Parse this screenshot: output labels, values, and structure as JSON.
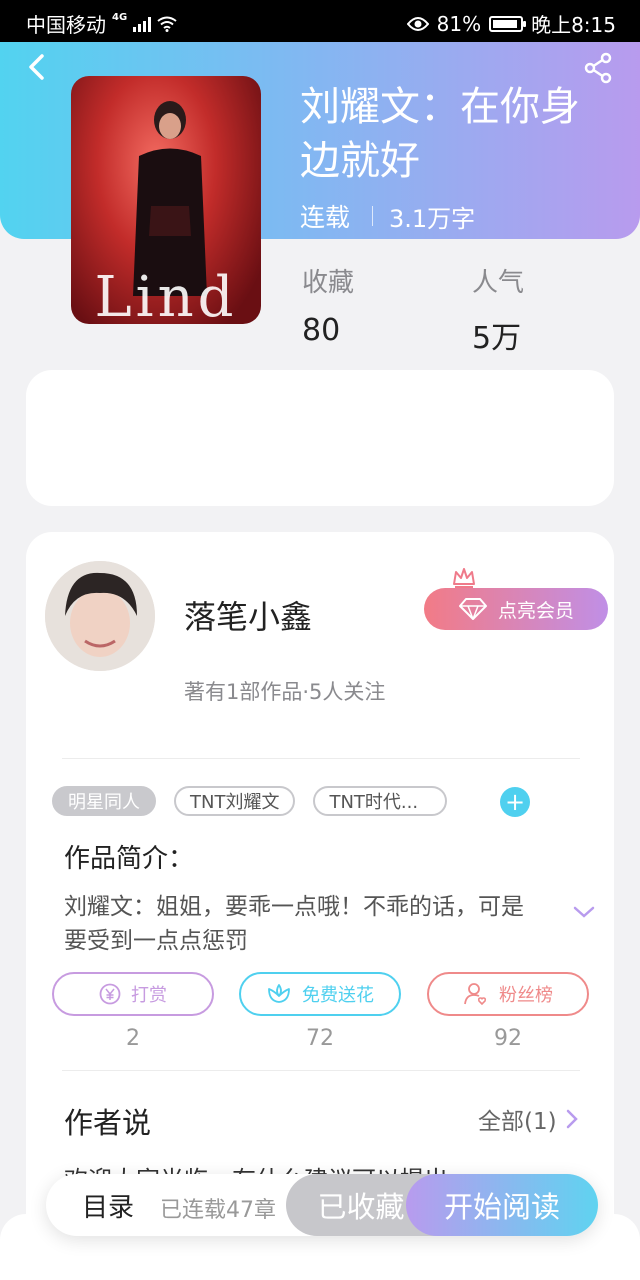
{
  "status_bar": {
    "carrier": "中国移动",
    "network": "4G",
    "battery_percent": "81%",
    "time": "晚上8:15"
  },
  "book": {
    "title": "刘耀文：在你身边就好",
    "status": "连载",
    "word_count": "3.1万字",
    "cover_text": "Lind",
    "stats": {
      "favorites_label": "收藏",
      "favorites_value": "80",
      "popularity_label": "人气",
      "popularity_value": "5万"
    }
  },
  "author": {
    "name": "落笔小鑫",
    "summary": "著有1部作品·5人关注",
    "vip_label": "点亮会员"
  },
  "tags": [
    "明星同人",
    "TNT刘耀文",
    "TNT时代..."
  ],
  "intro": {
    "title": "作品简介：",
    "text": "刘耀文：姐姐，要乖一点哦！不乖的话，可是要受到一点点惩罚"
  },
  "actions": [
    {
      "label": "打赏",
      "count": "2",
      "color": "#c79be0"
    },
    {
      "label": "免费送花",
      "count": "72",
      "color": "#4fd0ef"
    },
    {
      "label": "粉丝榜",
      "count": "92",
      "color": "#ef8a8a"
    }
  ],
  "author_says": {
    "title": "作者说",
    "all_label": "全部(1)",
    "teaser": "欢迎大家光临，有什么建议可以提出"
  },
  "bottom_bar": {
    "toc_label": "目录",
    "chapters_label": "已连载47章",
    "favorited_label": "已收藏",
    "read_label": "开始阅读"
  },
  "icons": [
    "back-arrow-icon",
    "share-icon",
    "eye-icon",
    "signal-icon",
    "wifi-icon",
    "battery-icon",
    "crown-icon",
    "diamond-icon",
    "add-tag-icon",
    "chevron-down-icon",
    "yen-coin-icon",
    "flower-icon",
    "fan-person-icon",
    "chevron-right-icon"
  ]
}
